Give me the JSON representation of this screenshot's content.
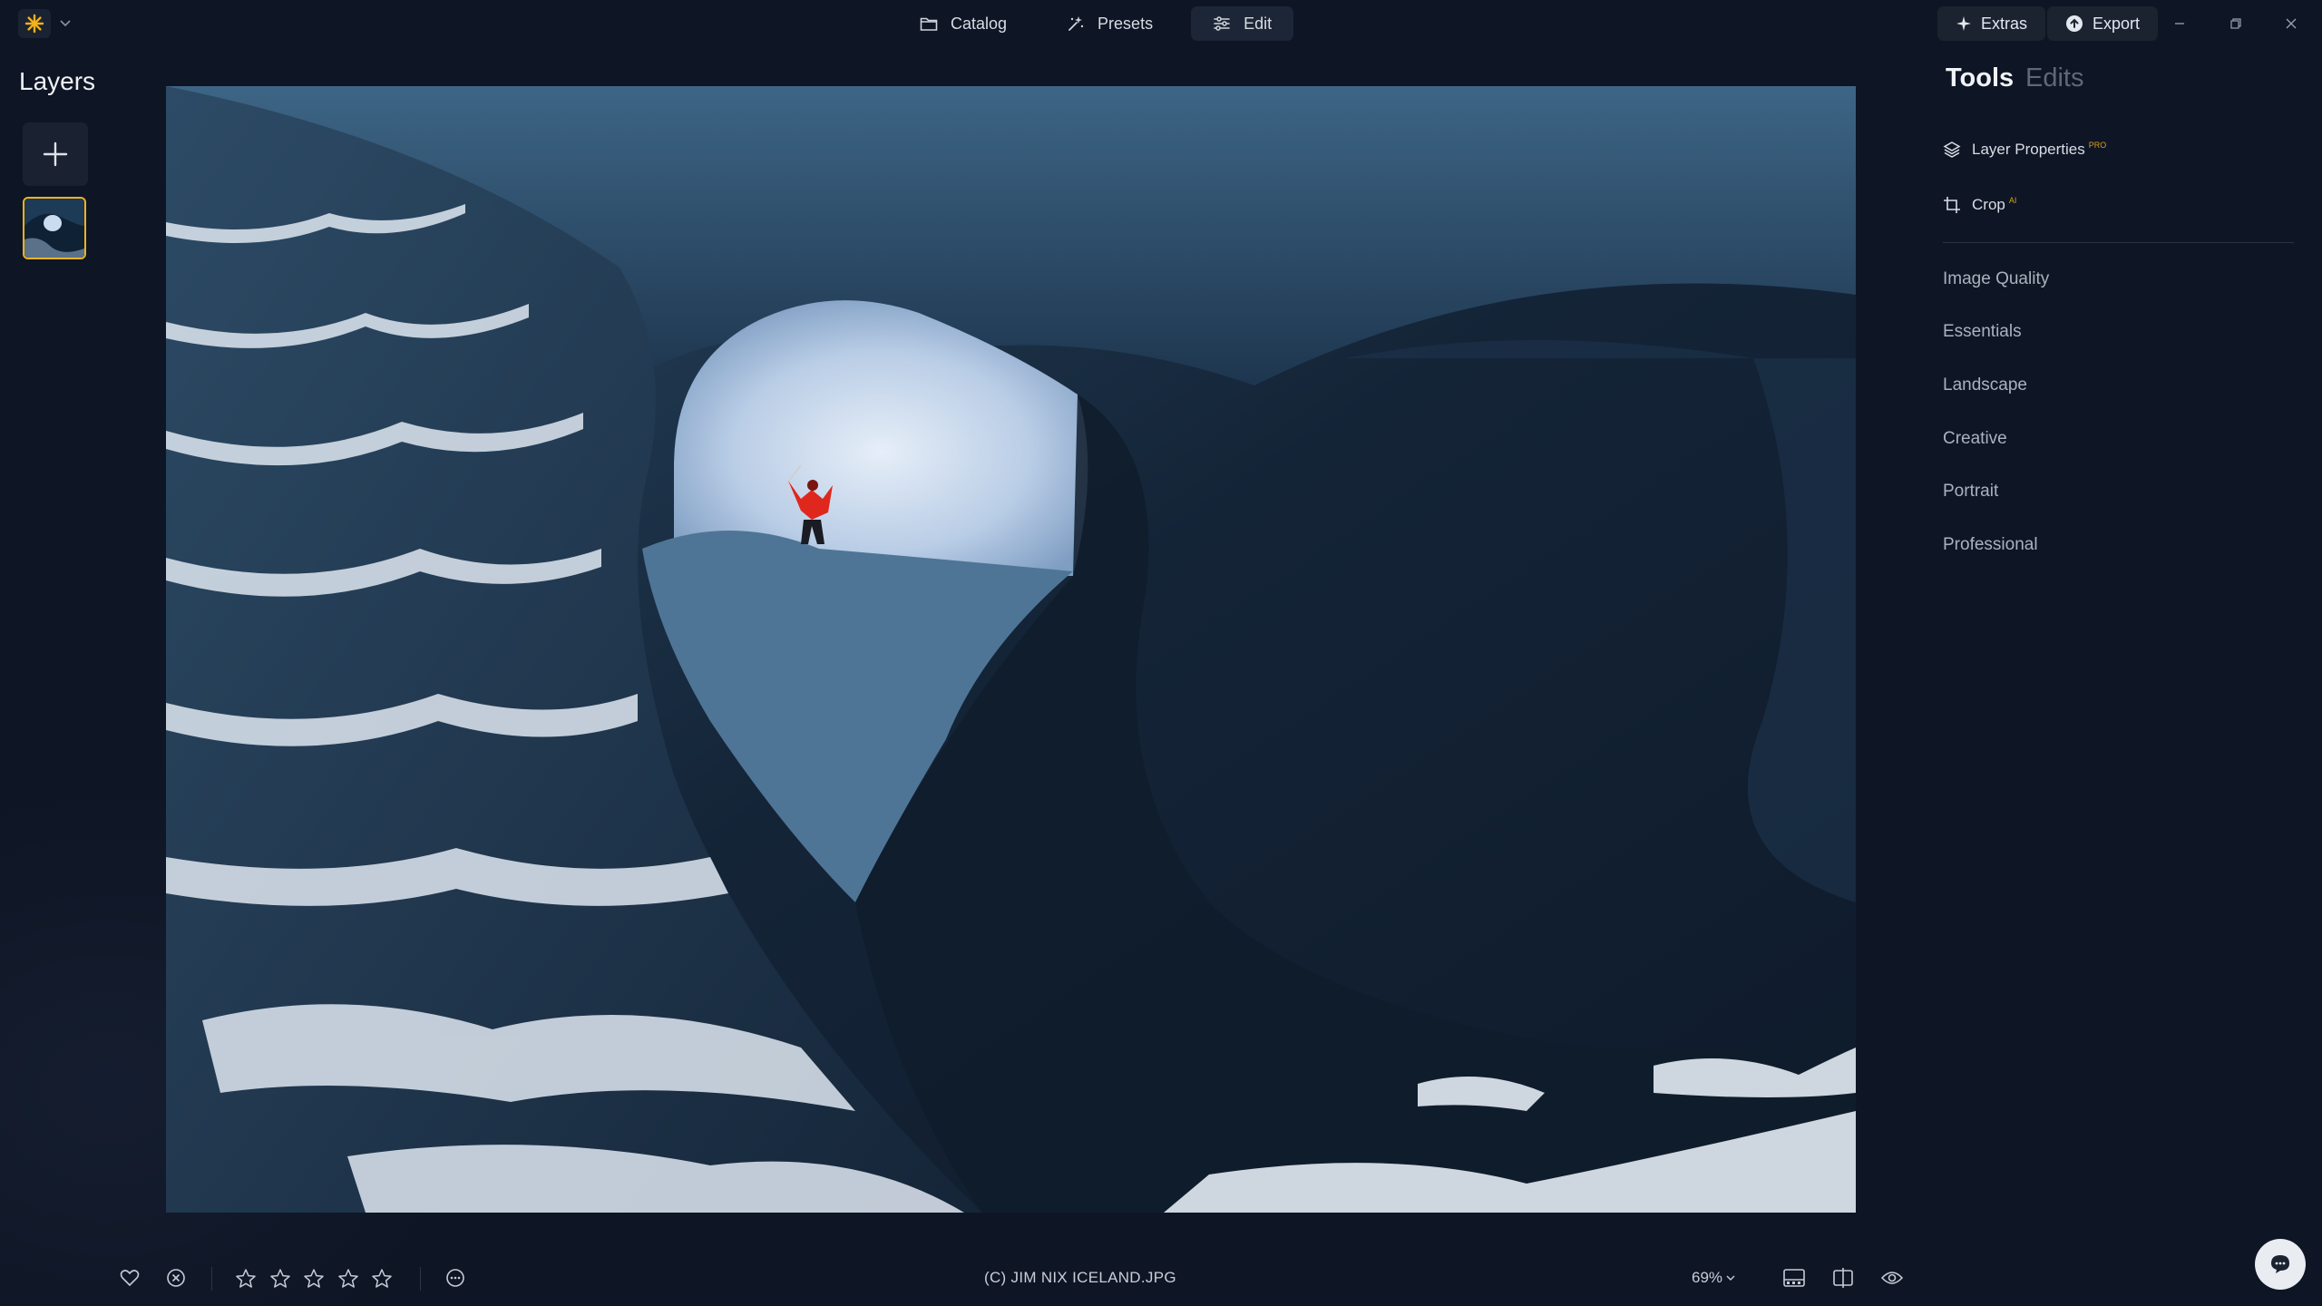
{
  "header": {
    "nav": [
      {
        "label": "Catalog",
        "icon": "folder-icon"
      },
      {
        "label": "Presets",
        "icon": "presets-sparkle-icon"
      },
      {
        "label": "Edit",
        "icon": "sliders-icon",
        "active": true
      }
    ],
    "extras_label": "Extras",
    "export_label": "Export"
  },
  "layers": {
    "title": "Layers"
  },
  "right_panel": {
    "tabs": {
      "tools": "Tools",
      "edits": "Edits"
    },
    "tools": [
      {
        "label": "Layer Properties",
        "badge": "PRO",
        "icon": "layers-icon"
      },
      {
        "label": "Crop",
        "badge": "AI",
        "icon": "crop-icon"
      }
    ],
    "categories": [
      "Image Quality",
      "Essentials",
      "Landscape",
      "Creative",
      "Portrait",
      "Professional"
    ]
  },
  "footer": {
    "filename": "(C) JIM NIX ICELAND.JPG",
    "zoom": "69%",
    "rating": 0,
    "max_rating": 5
  },
  "colors": {
    "accent": "#f2b21c",
    "background": "#0e1524",
    "panel": "#1b2331"
  }
}
